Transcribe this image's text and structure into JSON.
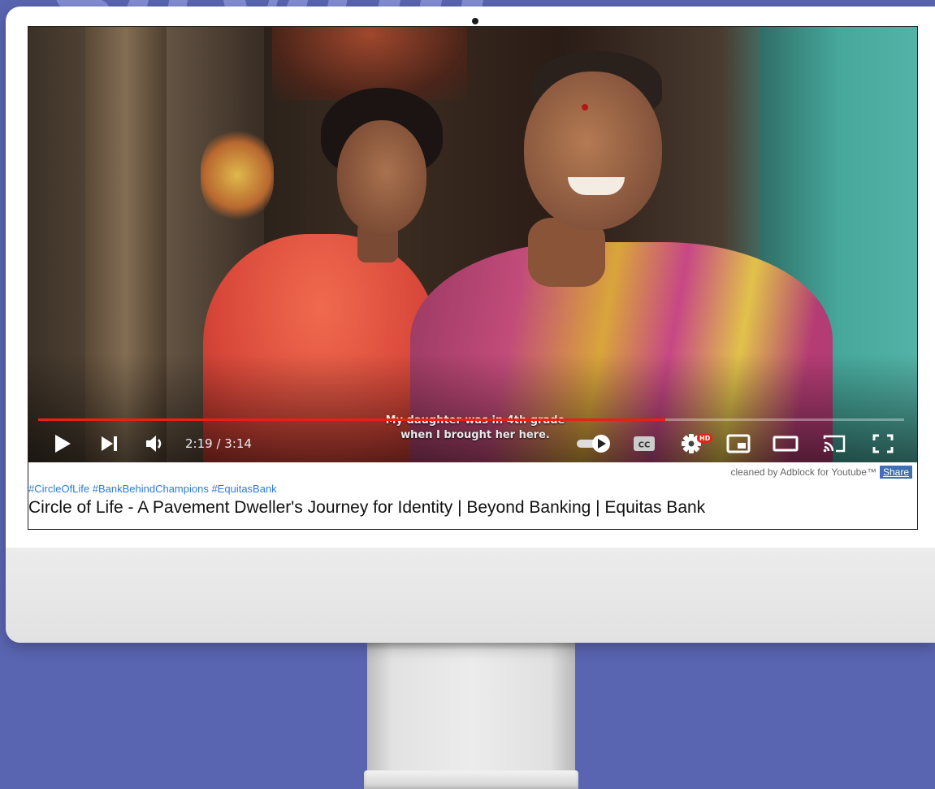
{
  "background": {
    "decor_text": "sayam",
    "color": "#5a65b2"
  },
  "player": {
    "subtitle_line1": "My daughter was in 4th grade",
    "subtitle_line2": "when I brought her here.",
    "time_display": "2:19 / 3:14",
    "progress_fraction": 0.724,
    "hd_badge": "HD",
    "accent_color": "#e62117",
    "controls": [
      "play-icon",
      "next-icon",
      "volume-icon",
      "autoplay-toggle-icon",
      "captions-icon",
      "settings-icon",
      "miniplayer-icon",
      "theater-icon",
      "cast-icon",
      "fullscreen-icon"
    ],
    "captions_label": "CC"
  },
  "info": {
    "adblock_text": "cleaned by Adblock for Youtube™",
    "share_label": "Share",
    "hashtags": "#CircleOfLife #BankBehindChampions #EquitasBank",
    "title": "Circle of Life - A Pavement Dweller's Journey for Identity | Beyond Banking | Equitas Bank"
  }
}
